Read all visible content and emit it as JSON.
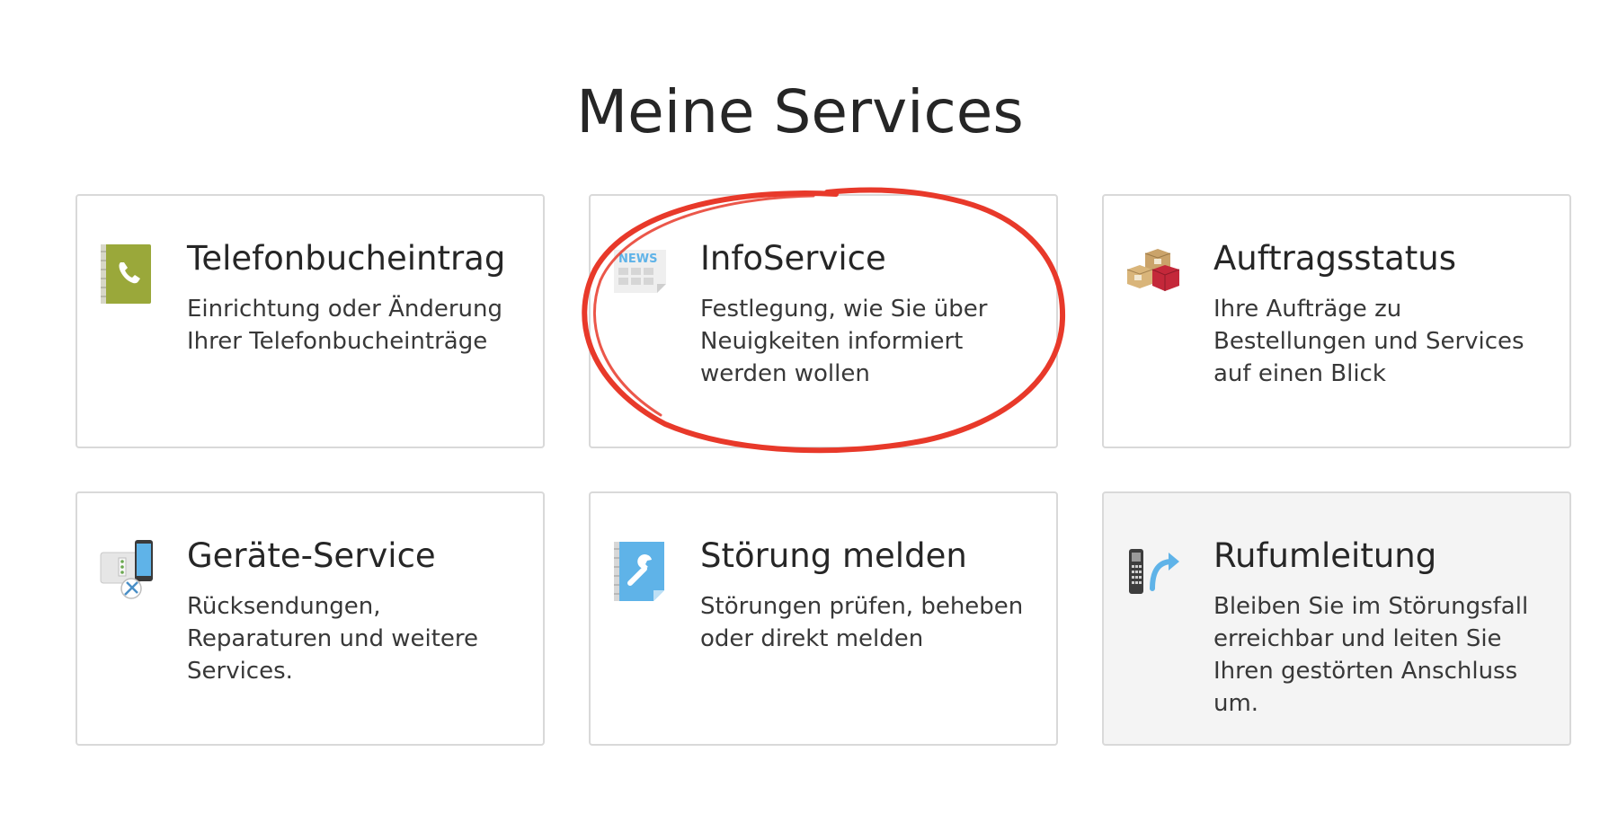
{
  "page": {
    "title": "Meine Services"
  },
  "services": [
    {
      "title": "Telefonbucheintrag",
      "description": "Einrichtung oder Änderung Ihrer Telefonbucheinträge",
      "icon": "phonebook-icon"
    },
    {
      "title": "InfoService",
      "description": "Festlegung, wie Sie über Neuigkeiten informiert werden wollen",
      "icon": "news-icon",
      "icon_text": "NEWS"
    },
    {
      "title": "Auftragsstatus",
      "description": "Ihre Aufträge zu Bestellungen und Services auf einen Blick",
      "icon": "packages-icon"
    },
    {
      "title": "Geräte-Service",
      "description": "Rücksendungen, Reparaturen und weitere Services.",
      "icon": "device-service-icon"
    },
    {
      "title": "Störung melden",
      "description": "Störungen prüfen, beheben oder direkt melden",
      "icon": "wrench-document-icon"
    },
    {
      "title": "Rufumleitung",
      "description": "Bleiben Sie im Störungsfall erreichbar und leiten Sie Ihren gestörten Anschluss um.",
      "icon": "call-forward-icon"
    }
  ],
  "colors": {
    "annotation": "#e8392a",
    "card_border": "#d9d9d9",
    "card_alt_background": "#f4f4f4",
    "text": "#262626",
    "icon_green": "#9aa83a",
    "icon_blue": "#5fb3e8"
  }
}
